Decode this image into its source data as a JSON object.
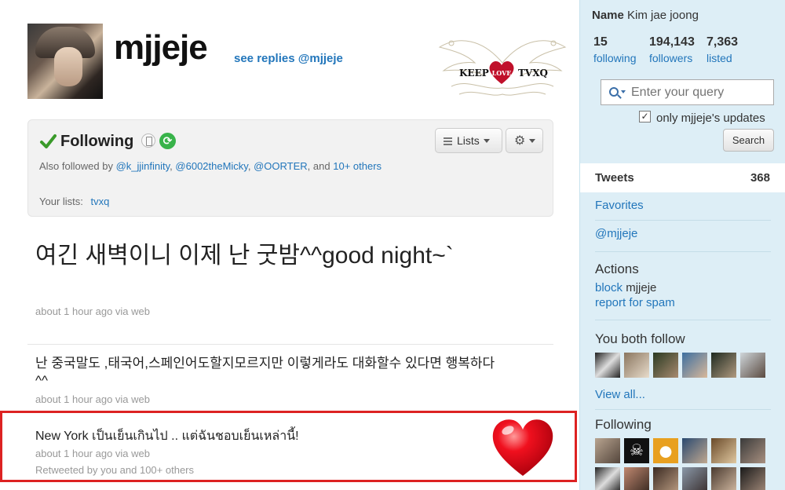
{
  "profile": {
    "screen_name": "mjjeje",
    "see_replies": "see replies @mjjeje"
  },
  "banner": {
    "left": "KEEP",
    "center": "LOVE",
    "right": "TVXQ"
  },
  "follow_box": {
    "status": "Following",
    "also_prefix": "Also followed by",
    "also_users": [
      "@k_jjinfinity",
      "@6002theMicky",
      "@OORTER"
    ],
    "also_and": "and",
    "also_more": "10+ others",
    "lists_label": "Your lists:",
    "list_name": "tvxq",
    "lists_button": "Lists"
  },
  "tweets": [
    {
      "text": "여긴 새벽이니 이제 난 굿밤^^good night~`",
      "meta": "about 1 hour ago via web"
    },
    {
      "text": "난 중국말도 ,태국어,스페인어도할지모르지만 이렇게라도 대화할수 있다면 행복하다^^",
      "meta": "about 1 hour ago via web"
    },
    {
      "text": "New York เป็นเย็นเกินไป .. แต่ฉันชอบเย็นเหล่านี้!",
      "meta": "about 1 hour ago via web",
      "retweeted": "Retweeted by you and 100+ others"
    }
  ],
  "sidebar": {
    "name_label": "Name",
    "name_value": "Kim jae joong",
    "stats": [
      {
        "num": "15",
        "label": "following"
      },
      {
        "num": "194,143",
        "label": "followers"
      },
      {
        "num": "7,363",
        "label": "listed"
      }
    ],
    "search_placeholder": "Enter your query",
    "only_label": "only mjjeje's updates",
    "search_button": "Search",
    "tweets_label": "Tweets",
    "tweets_count": "368",
    "favorites": "Favorites",
    "mention": "@mjjeje",
    "actions_head": "Actions",
    "block_link": "block",
    "block_user": "mjjeje",
    "report_spam": "report for spam",
    "both_follow_head": "You both follow",
    "view_all": "View all...",
    "following_head": "Following"
  },
  "colors": {
    "link": "#2276bb",
    "sidebar_bg": "#ddeef6",
    "highlight": "#dd2222",
    "heart": "#e0101e"
  }
}
